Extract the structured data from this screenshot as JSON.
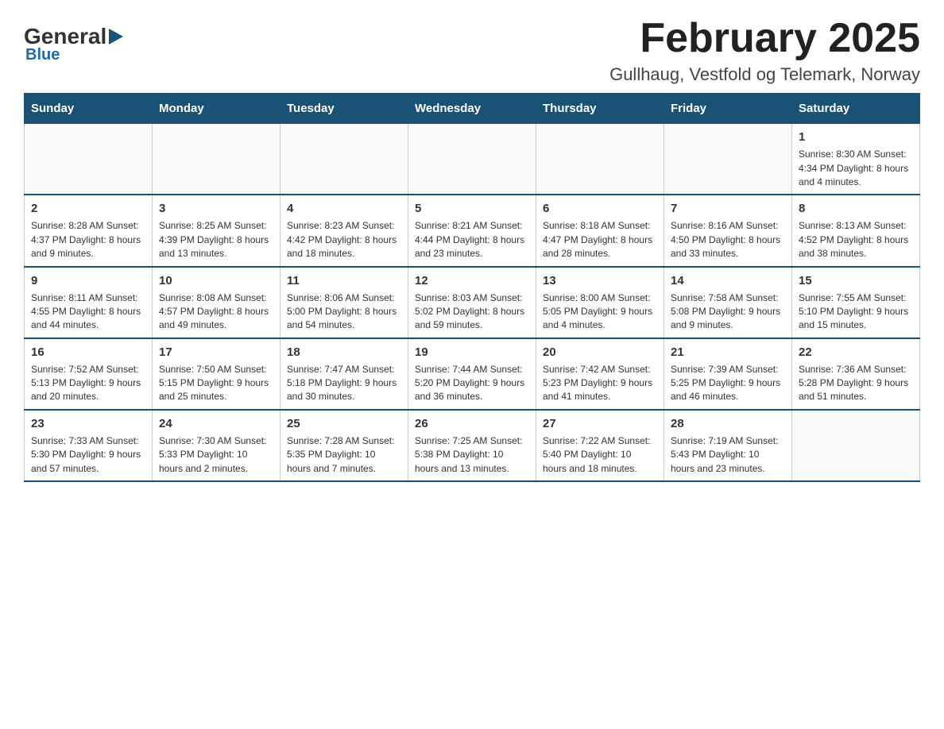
{
  "header": {
    "logo_general": "General",
    "logo_blue": "Blue",
    "main_title": "February 2025",
    "subtitle": "Gullhaug, Vestfold og Telemark, Norway"
  },
  "calendar": {
    "days_of_week": [
      "Sunday",
      "Monday",
      "Tuesday",
      "Wednesday",
      "Thursday",
      "Friday",
      "Saturday"
    ],
    "weeks": [
      [
        {
          "day": "",
          "info": ""
        },
        {
          "day": "",
          "info": ""
        },
        {
          "day": "",
          "info": ""
        },
        {
          "day": "",
          "info": ""
        },
        {
          "day": "",
          "info": ""
        },
        {
          "day": "",
          "info": ""
        },
        {
          "day": "1",
          "info": "Sunrise: 8:30 AM\nSunset: 4:34 PM\nDaylight: 8 hours\nand 4 minutes."
        }
      ],
      [
        {
          "day": "2",
          "info": "Sunrise: 8:28 AM\nSunset: 4:37 PM\nDaylight: 8 hours\nand 9 minutes."
        },
        {
          "day": "3",
          "info": "Sunrise: 8:25 AM\nSunset: 4:39 PM\nDaylight: 8 hours\nand 13 minutes."
        },
        {
          "day": "4",
          "info": "Sunrise: 8:23 AM\nSunset: 4:42 PM\nDaylight: 8 hours\nand 18 minutes."
        },
        {
          "day": "5",
          "info": "Sunrise: 8:21 AM\nSunset: 4:44 PM\nDaylight: 8 hours\nand 23 minutes."
        },
        {
          "day": "6",
          "info": "Sunrise: 8:18 AM\nSunset: 4:47 PM\nDaylight: 8 hours\nand 28 minutes."
        },
        {
          "day": "7",
          "info": "Sunrise: 8:16 AM\nSunset: 4:50 PM\nDaylight: 8 hours\nand 33 minutes."
        },
        {
          "day": "8",
          "info": "Sunrise: 8:13 AM\nSunset: 4:52 PM\nDaylight: 8 hours\nand 38 minutes."
        }
      ],
      [
        {
          "day": "9",
          "info": "Sunrise: 8:11 AM\nSunset: 4:55 PM\nDaylight: 8 hours\nand 44 minutes."
        },
        {
          "day": "10",
          "info": "Sunrise: 8:08 AM\nSunset: 4:57 PM\nDaylight: 8 hours\nand 49 minutes."
        },
        {
          "day": "11",
          "info": "Sunrise: 8:06 AM\nSunset: 5:00 PM\nDaylight: 8 hours\nand 54 minutes."
        },
        {
          "day": "12",
          "info": "Sunrise: 8:03 AM\nSunset: 5:02 PM\nDaylight: 8 hours\nand 59 minutes."
        },
        {
          "day": "13",
          "info": "Sunrise: 8:00 AM\nSunset: 5:05 PM\nDaylight: 9 hours\nand 4 minutes."
        },
        {
          "day": "14",
          "info": "Sunrise: 7:58 AM\nSunset: 5:08 PM\nDaylight: 9 hours\nand 9 minutes."
        },
        {
          "day": "15",
          "info": "Sunrise: 7:55 AM\nSunset: 5:10 PM\nDaylight: 9 hours\nand 15 minutes."
        }
      ],
      [
        {
          "day": "16",
          "info": "Sunrise: 7:52 AM\nSunset: 5:13 PM\nDaylight: 9 hours\nand 20 minutes."
        },
        {
          "day": "17",
          "info": "Sunrise: 7:50 AM\nSunset: 5:15 PM\nDaylight: 9 hours\nand 25 minutes."
        },
        {
          "day": "18",
          "info": "Sunrise: 7:47 AM\nSunset: 5:18 PM\nDaylight: 9 hours\nand 30 minutes."
        },
        {
          "day": "19",
          "info": "Sunrise: 7:44 AM\nSunset: 5:20 PM\nDaylight: 9 hours\nand 36 minutes."
        },
        {
          "day": "20",
          "info": "Sunrise: 7:42 AM\nSunset: 5:23 PM\nDaylight: 9 hours\nand 41 minutes."
        },
        {
          "day": "21",
          "info": "Sunrise: 7:39 AM\nSunset: 5:25 PM\nDaylight: 9 hours\nand 46 minutes."
        },
        {
          "day": "22",
          "info": "Sunrise: 7:36 AM\nSunset: 5:28 PM\nDaylight: 9 hours\nand 51 minutes."
        }
      ],
      [
        {
          "day": "23",
          "info": "Sunrise: 7:33 AM\nSunset: 5:30 PM\nDaylight: 9 hours\nand 57 minutes."
        },
        {
          "day": "24",
          "info": "Sunrise: 7:30 AM\nSunset: 5:33 PM\nDaylight: 10 hours\nand 2 minutes."
        },
        {
          "day": "25",
          "info": "Sunrise: 7:28 AM\nSunset: 5:35 PM\nDaylight: 10 hours\nand 7 minutes."
        },
        {
          "day": "26",
          "info": "Sunrise: 7:25 AM\nSunset: 5:38 PM\nDaylight: 10 hours\nand 13 minutes."
        },
        {
          "day": "27",
          "info": "Sunrise: 7:22 AM\nSunset: 5:40 PM\nDaylight: 10 hours\nand 18 minutes."
        },
        {
          "day": "28",
          "info": "Sunrise: 7:19 AM\nSunset: 5:43 PM\nDaylight: 10 hours\nand 23 minutes."
        },
        {
          "day": "",
          "info": ""
        }
      ]
    ]
  }
}
